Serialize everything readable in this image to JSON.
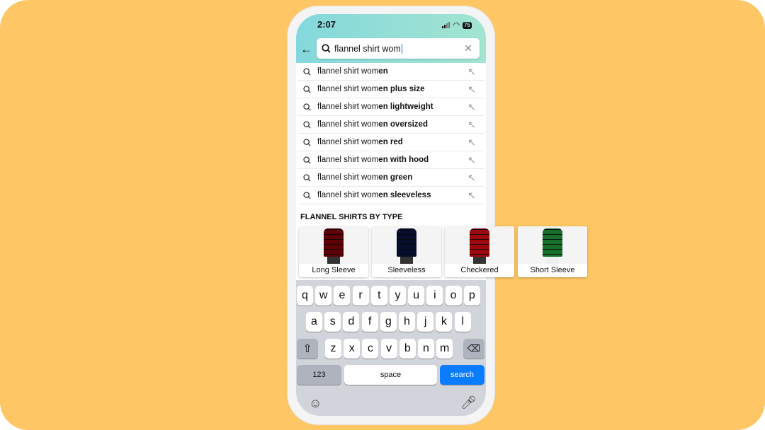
{
  "status": {
    "time": "2:07",
    "battery": "75"
  },
  "search": {
    "query": "flannel shirt wom"
  },
  "suggestions": [
    {
      "prefix": "flannel shirt wom",
      "suffix": "en"
    },
    {
      "prefix": "flannel shirt wom",
      "suffix": "en plus size"
    },
    {
      "prefix": "flannel shirt wom",
      "suffix": "en lightweight"
    },
    {
      "prefix": "flannel shirt wom",
      "suffix": "en oversized"
    },
    {
      "prefix": "flannel shirt wom",
      "suffix": "en red"
    },
    {
      "prefix": "flannel shirt wom",
      "suffix": "en with hood"
    },
    {
      "prefix": "flannel shirt wom",
      "suffix": "en green"
    },
    {
      "prefix": "flannel shirt wom",
      "suffix": "en sleeveless"
    }
  ],
  "section_title": "FLANNEL SHIRTS BY TYPE",
  "types": [
    {
      "label": "Long Sleeve",
      "color": "#9a1c2c"
    },
    {
      "label": "Sleeveless",
      "color": "#2a3a6a"
    },
    {
      "label": "Checkered",
      "color": "#c8323a"
    },
    {
      "label": "Short Sleeve",
      "color": "#4fa86a"
    }
  ],
  "keyboard": {
    "row1": [
      "q",
      "w",
      "e",
      "r",
      "t",
      "y",
      "u",
      "i",
      "o",
      "p"
    ],
    "row2": [
      "a",
      "s",
      "d",
      "f",
      "g",
      "h",
      "j",
      "k",
      "l"
    ],
    "row3": [
      "z",
      "x",
      "c",
      "v",
      "b",
      "n",
      "m"
    ],
    "numbers": "123",
    "space": "space",
    "search": "search"
  },
  "colors": {
    "accent": "#0a7cff",
    "background": "#fec664"
  }
}
